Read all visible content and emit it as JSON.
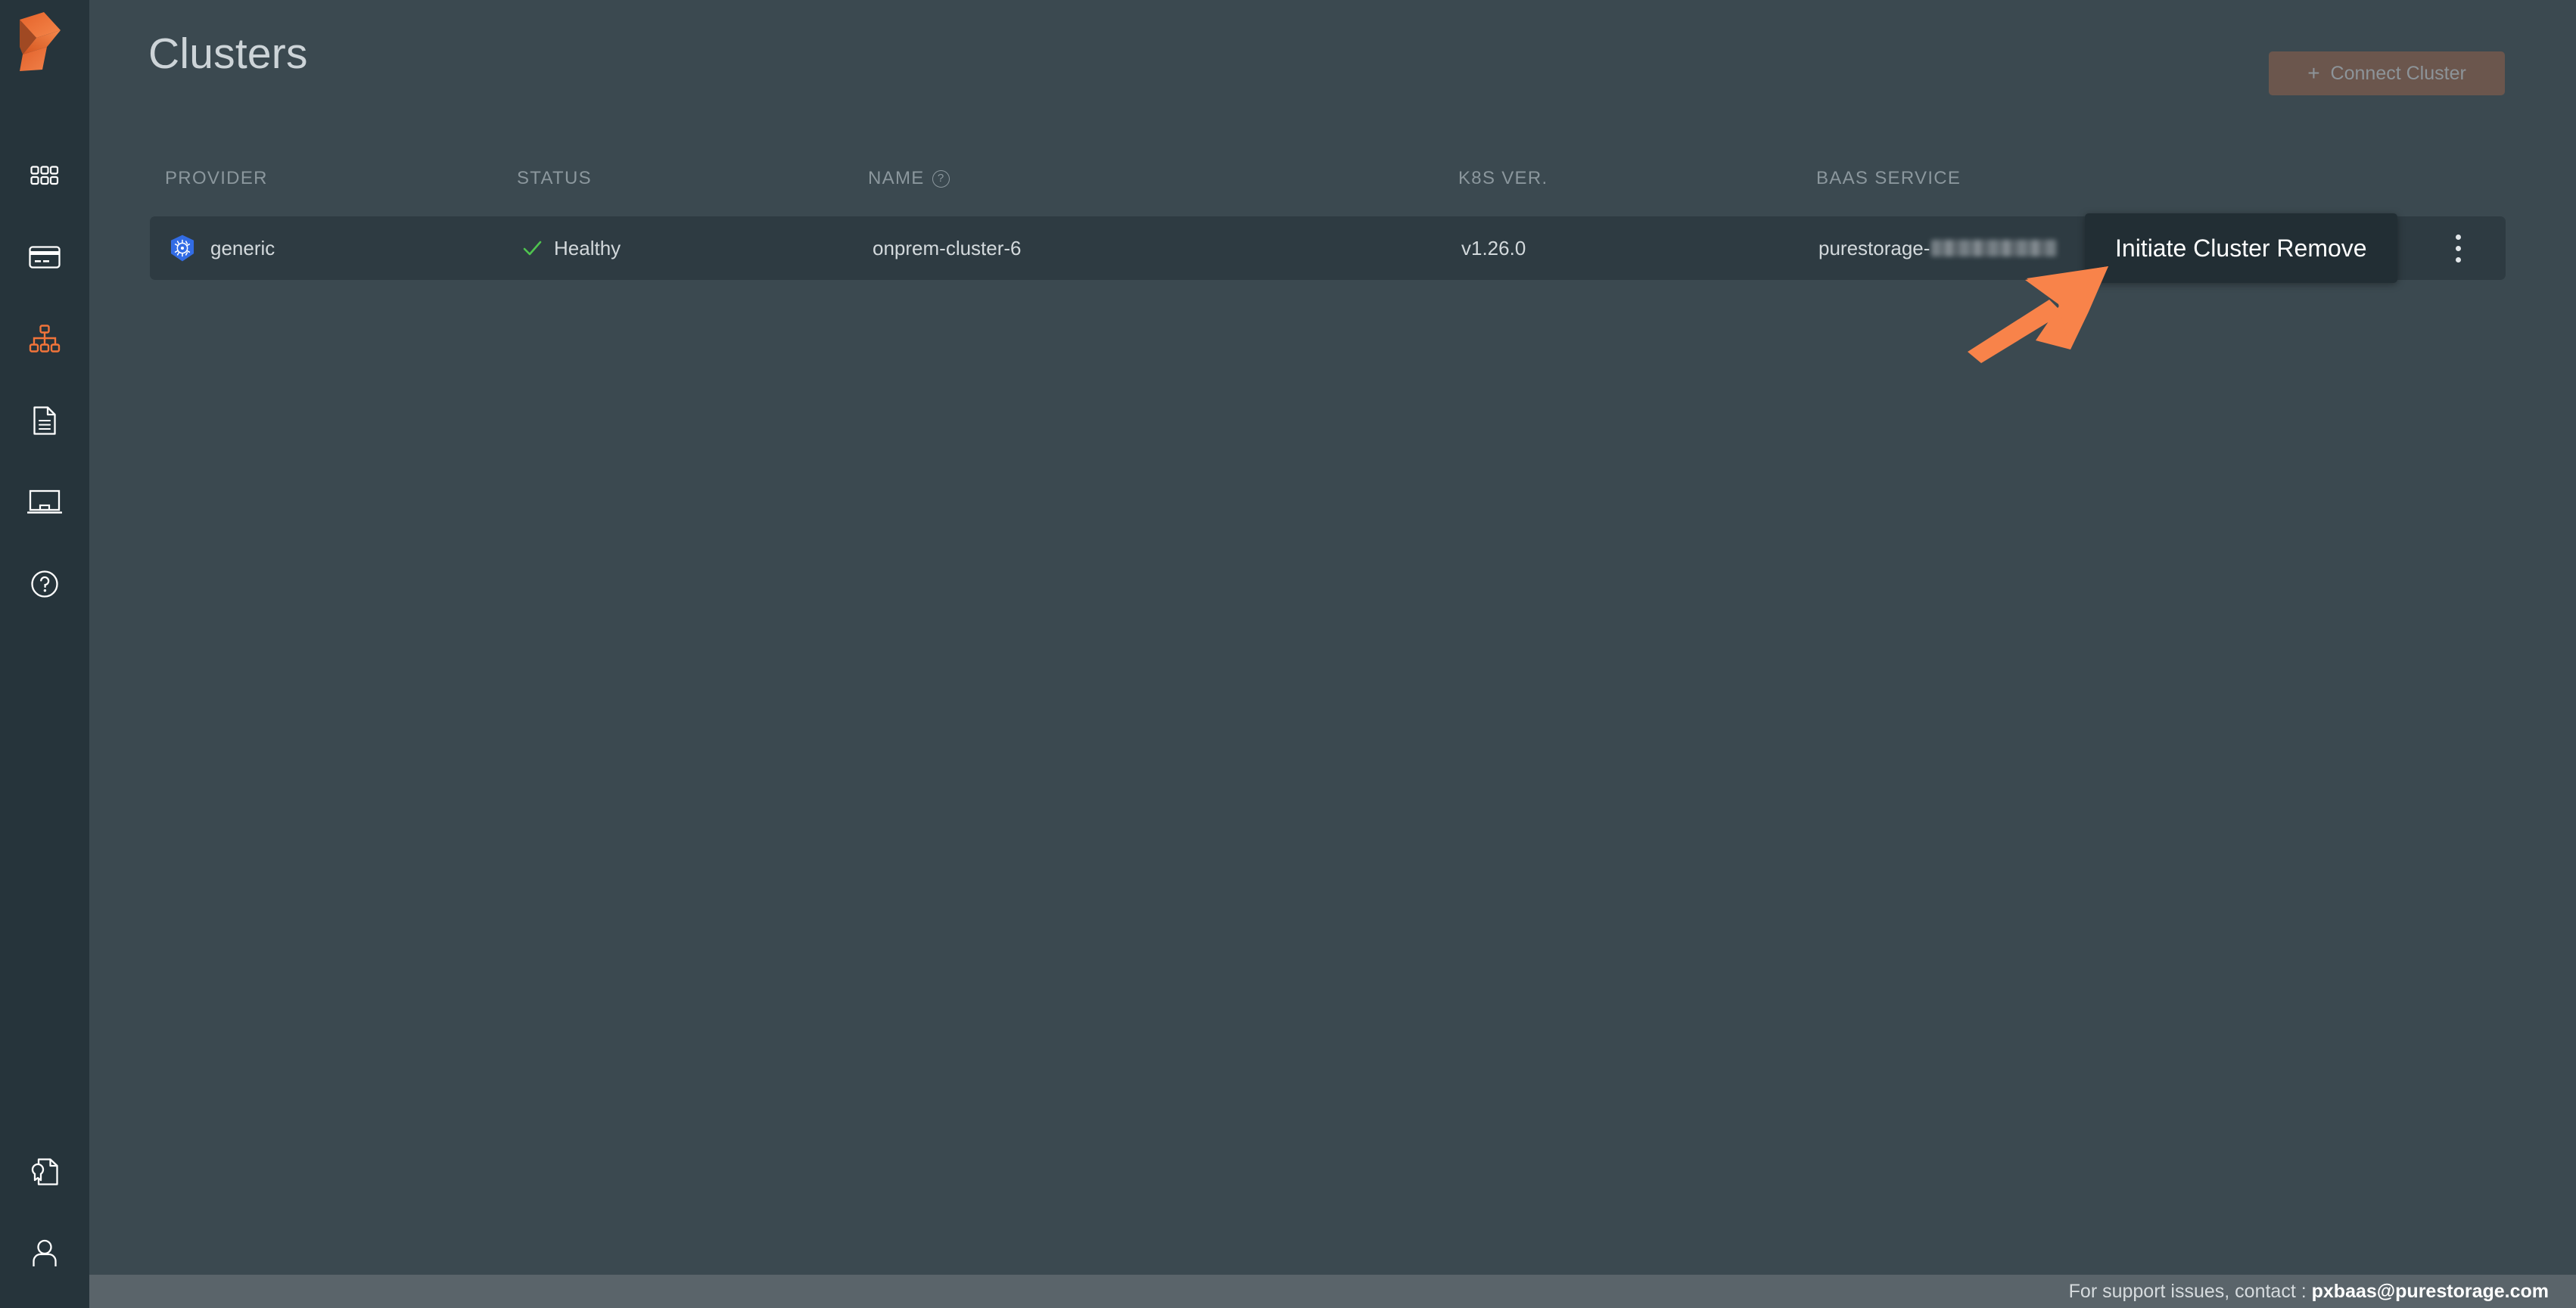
{
  "app": {
    "logo": "portworx-logo",
    "accent_color": "#f2743a",
    "background_color": "#3b4950",
    "sidebar_color": "#26343b"
  },
  "sidebar": {
    "items": [
      {
        "id": "apps",
        "icon": "grid-apps-icon",
        "label": "Apps",
        "active": false
      },
      {
        "id": "billing",
        "icon": "credit-card-icon",
        "label": "Billing",
        "active": false
      },
      {
        "id": "clusters",
        "icon": "sitemap-icon",
        "label": "Clusters",
        "active": true
      },
      {
        "id": "reports",
        "icon": "document-icon",
        "label": "Reports",
        "active": false
      },
      {
        "id": "console",
        "icon": "monitor-icon",
        "label": "Console",
        "active": false
      },
      {
        "id": "help",
        "icon": "help-circle-icon",
        "label": "Help",
        "active": false
      }
    ],
    "bottom_items": [
      {
        "id": "license",
        "icon": "license-badge-icon",
        "label": "License",
        "active": false
      },
      {
        "id": "account",
        "icon": "user-icon",
        "label": "Account",
        "active": false
      }
    ]
  },
  "header": {
    "title": "Clusters",
    "connect_button": {
      "label": "Connect Cluster",
      "plus": "+",
      "disabled": true
    }
  },
  "table": {
    "columns": [
      {
        "key": "provider",
        "label": "PROVIDER",
        "help": false
      },
      {
        "key": "status",
        "label": "STATUS",
        "help": false
      },
      {
        "key": "name",
        "label": "NAME",
        "help": true,
        "help_glyph": "?"
      },
      {
        "key": "k8s",
        "label": "K8S VER.",
        "help": false
      },
      {
        "key": "baas",
        "label": "BAAS SERVICE",
        "help": false
      }
    ],
    "rows": [
      {
        "provider": "generic",
        "provider_icon": "kubernetes-icon",
        "status": "Healthy",
        "status_icon": "check-icon",
        "status_color": "#4fc44f",
        "name": "onprem-cluster-6",
        "k8s_version": "v1.26.0",
        "baas_service": "purestorage-",
        "baas_service_redacted": true,
        "menu_icon": "kebab-menu-icon"
      }
    ]
  },
  "tooltip": {
    "text": "Initiate Cluster Remove",
    "target": "kebab-menu-icon"
  },
  "annotation": {
    "type": "arrow",
    "color": "#f8834a",
    "points_to": "kebab-menu-icon"
  },
  "footer": {
    "prefix": "For support issues, contact : ",
    "email": "pxbaas@purestorage.com"
  }
}
